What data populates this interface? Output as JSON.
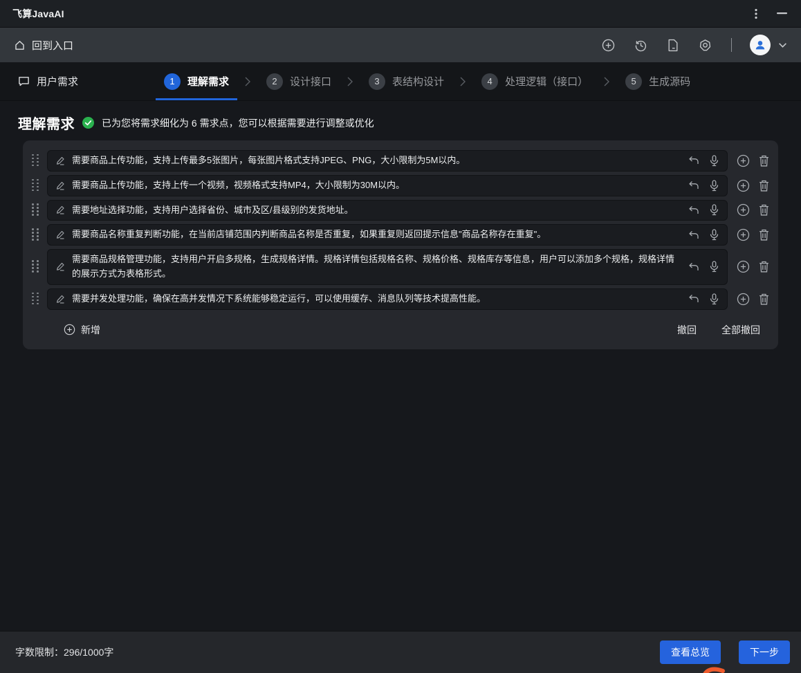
{
  "title_bar": {
    "app_title": "飞算JavaAI"
  },
  "toolbar": {
    "back_label": "回到入口"
  },
  "steps_bar": {
    "requirement_tab_label": "用户需求",
    "steps": [
      {
        "num": "1",
        "label": "理解需求",
        "active": true
      },
      {
        "num": "2",
        "label": "设计接口",
        "active": false
      },
      {
        "num": "3",
        "label": "表结构设计",
        "active": false
      },
      {
        "num": "4",
        "label": "处理逻辑（接口）",
        "active": false
      },
      {
        "num": "5",
        "label": "生成源码",
        "active": false
      }
    ]
  },
  "content": {
    "heading": "理解需求",
    "status_message": "已为您将需求细化为 6 需求点，您可以根据需要进行调整或优化",
    "requirements": [
      "需要商品上传功能，支持上传最多5张图片，每张图片格式支持JPEG、PNG，大小限制为5M以内。",
      "需要商品上传功能，支持上传一个视频，视频格式支持MP4，大小限制为30M以内。",
      "需要地址选择功能，支持用户选择省份、城市及区/县级别的发货地址。",
      "需要商品名称重复判断功能，在当前店铺范围内判断商品名称是否重复，如果重复则返回提示信息\"商品名称存在重复\"。",
      "需要商品规格管理功能，支持用户开启多规格，生成规格详情。规格详情包括规格名称、规格价格、规格库存等信息，用户可以添加多个规格，规格详情的展示方式为表格形式。",
      "需要并发处理功能，确保在高并发情况下系统能够稳定运行，可以使用缓存、消息队列等技术提高性能。"
    ],
    "add_label": "新增",
    "undo_label": "撤回",
    "undo_all_label": "全部撤回"
  },
  "footer": {
    "char_limit": "字数限制：296/1000字",
    "overview_button": "查看总览",
    "next_button": "下一步"
  },
  "icons": {
    "more": "vertical-ellipsis",
    "minimize": "—",
    "home": "house outline",
    "new_session": "plus-circle",
    "history": "clock-undo",
    "document": "file outline",
    "settings": "gear",
    "avatar": "person",
    "chevron_down": "⌄",
    "comment": "speech-bubble",
    "success": "green check circle",
    "drag": "dot-grid",
    "edit": "pencil",
    "undo": "curved-left-arrow",
    "mic": "microphone",
    "add": "plus-circle",
    "delete": "trash"
  },
  "colors": {
    "accent_blue": "#2563dd",
    "success_green": "#2ab14e",
    "panel_bg": "#26282d",
    "row_bg": "#1a1c20",
    "toolbar_bg": "#33373c",
    "deco_orange": "#ee5a2b"
  }
}
